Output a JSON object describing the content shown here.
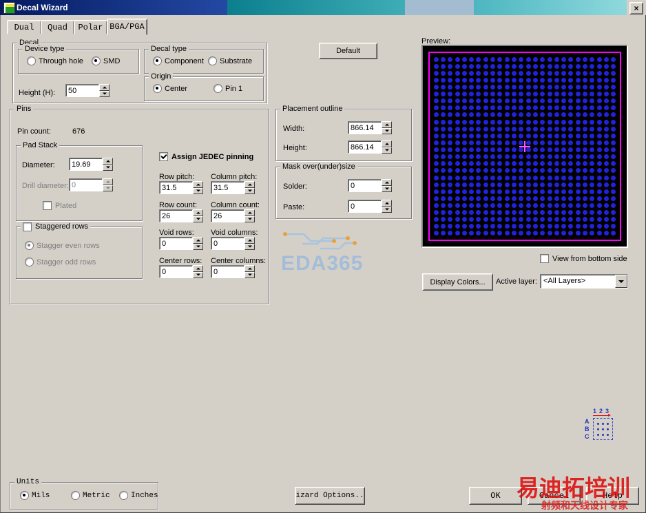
{
  "window": {
    "title": "Decal Wizard",
    "close_glyph": "×"
  },
  "tabs": {
    "items": [
      {
        "label": "Dual"
      },
      {
        "label": "Quad"
      },
      {
        "label": "Polar"
      },
      {
        "label": "BGA/PGA"
      }
    ]
  },
  "decal": {
    "legend": "Decal",
    "device_type": {
      "legend": "Device type",
      "opt1": "Through hole",
      "opt2": "SMD"
    },
    "decal_type": {
      "legend": "Decal type",
      "opt1": "Component",
      "opt2": "Substrate"
    },
    "height_label": "Height (H):",
    "height_value": "50",
    "origin": {
      "legend": "Origin",
      "opt1": "Center",
      "opt2": "Pin 1"
    }
  },
  "default_button": "Default",
  "pins": {
    "legend": "Pins",
    "pin_count_label": "Pin count:",
    "pin_count_value": "676",
    "pad_stack": {
      "legend": "Pad Stack",
      "diameter_label": "Diameter:",
      "diameter_value": "19.69",
      "drill_label": "Drill diameter:",
      "drill_value": "0",
      "plated_label": "Plated"
    },
    "staggered": {
      "legend": "Staggered rows",
      "opt1": "Stagger even rows",
      "opt2": "Stagger odd rows"
    },
    "jedec_label": "Assign JEDEC pinning",
    "row_pitch_label": "Row pitch:",
    "row_pitch_value": "31.5",
    "col_pitch_label": "Column pitch:",
    "col_pitch_value": "31.5",
    "row_count_label": "Row count:",
    "row_count_value": "26",
    "col_count_label": "Column count:",
    "col_count_value": "26",
    "void_rows_label": "Void rows:",
    "void_rows_value": "0",
    "void_cols_label": "Void columns:",
    "void_cols_value": "0",
    "center_rows_label": "Center rows:",
    "center_rows_value": "0",
    "center_cols_label": "Center columns:",
    "center_cols_value": "0"
  },
  "placement": {
    "legend": "Placement outline",
    "width_label": "Width:",
    "width_value": "866.14",
    "height_label": "Height:",
    "height_value": "866.14"
  },
  "mask": {
    "legend": "Mask over(under)size",
    "solder_label": "Solder:",
    "solder_value": "0",
    "paste_label": "Paste:",
    "paste_value": "0"
  },
  "logo": {
    "text": "EDA365",
    "trace_color": "#a9c4de",
    "pad_color": "#e9a13c"
  },
  "preview": {
    "label": "Preview:",
    "rows": 26,
    "cols": 26,
    "dot_color": "#2222dd",
    "outline_color": "#ff00ff",
    "background": "#000000",
    "view_bottom_label": "View from bottom side",
    "display_colors_button": "Display Colors...",
    "active_layer_label": "Active layer:",
    "active_layer_value": "<All Layers>"
  },
  "pin_key": {
    "numbers": "123",
    "letters": [
      "A",
      "B",
      "C"
    ]
  },
  "units": {
    "legend": "Units",
    "opt1": "Mils",
    "opt2": "Metric",
    "opt3": "Inches"
  },
  "footer": {
    "wizard_options_button": "izard Options..",
    "ok_button": "OK",
    "cancel_button": "Cancel",
    "help_button": "Help"
  },
  "watermark": {
    "line1": "易迪拓培训",
    "line2": "射频和天线设计专家",
    "color": "#dd1111"
  }
}
